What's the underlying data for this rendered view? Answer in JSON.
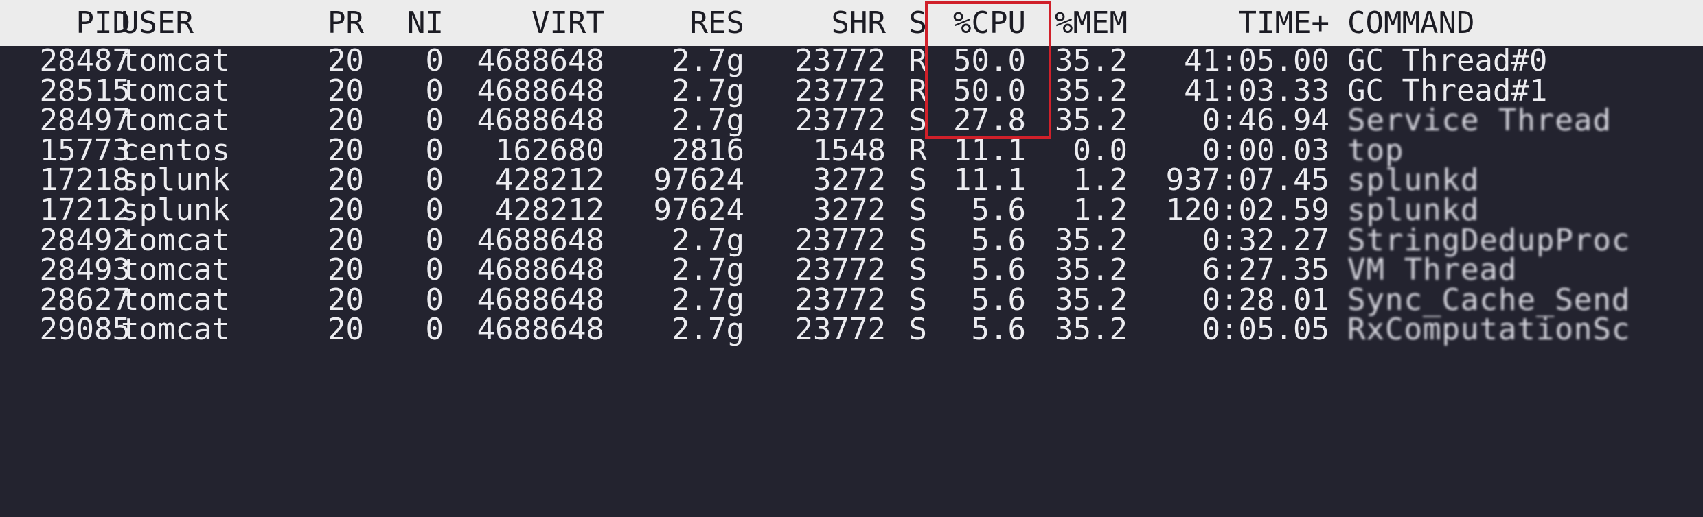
{
  "header": {
    "pid": "PID",
    "user": "USER",
    "pr": "PR",
    "ni": "NI",
    "virt": "VIRT",
    "res": "RES",
    "shr": "SHR",
    "s": "S",
    "cpu": "%CPU",
    "mem": "%MEM",
    "time": "TIME+",
    "command": "COMMAND"
  },
  "processes": [
    {
      "pid": "28487",
      "user": "tomcat",
      "pr": "20",
      "ni": "0",
      "virt": "4688648",
      "res": "2.7g",
      "shr": "23772",
      "s": "R",
      "cpu": "50.0",
      "mem": "35.2",
      "time": "41:05.00",
      "command": "GC Thread#0"
    },
    {
      "pid": "28515",
      "user": "tomcat",
      "pr": "20",
      "ni": "0",
      "virt": "4688648",
      "res": "2.7g",
      "shr": "23772",
      "s": "R",
      "cpu": "50.0",
      "mem": "35.2",
      "time": "41:03.33",
      "command": "GC Thread#1"
    },
    {
      "pid": "28497",
      "user": "tomcat",
      "pr": "20",
      "ni": "0",
      "virt": "4688648",
      "res": "2.7g",
      "shr": "23772",
      "s": "S",
      "cpu": "27.8",
      "mem": "35.2",
      "time": "0:46.94",
      "command": "Service Thread"
    },
    {
      "pid": "15773",
      "user": "centos",
      "pr": "20",
      "ni": "0",
      "virt": "162680",
      "res": "2816",
      "shr": "1548",
      "s": "R",
      "cpu": "11.1",
      "mem": "0.0",
      "time": "0:00.03",
      "command": "top"
    },
    {
      "pid": "17218",
      "user": "splunk",
      "pr": "20",
      "ni": "0",
      "virt": "428212",
      "res": "97624",
      "shr": "3272",
      "s": "S",
      "cpu": "11.1",
      "mem": "1.2",
      "time": "937:07.45",
      "command": "splunkd"
    },
    {
      "pid": "17212",
      "user": "splunk",
      "pr": "20",
      "ni": "0",
      "virt": "428212",
      "res": "97624",
      "shr": "3272",
      "s": "S",
      "cpu": "5.6",
      "mem": "1.2",
      "time": "120:02.59",
      "command": "splunkd"
    },
    {
      "pid": "28492",
      "user": "tomcat",
      "pr": "20",
      "ni": "0",
      "virt": "4688648",
      "res": "2.7g",
      "shr": "23772",
      "s": "S",
      "cpu": "5.6",
      "mem": "35.2",
      "time": "0:32.27",
      "command": "StringDedupProc"
    },
    {
      "pid": "28493",
      "user": "tomcat",
      "pr": "20",
      "ni": "0",
      "virt": "4688648",
      "res": "2.7g",
      "shr": "23772",
      "s": "S",
      "cpu": "5.6",
      "mem": "35.2",
      "time": "6:27.35",
      "command": "VM Thread"
    },
    {
      "pid": "28627",
      "user": "tomcat",
      "pr": "20",
      "ni": "0",
      "virt": "4688648",
      "res": "2.7g",
      "shr": "23772",
      "s": "S",
      "cpu": "5.6",
      "mem": "35.2",
      "time": "0:28.01",
      "command": "Sync_Cache_Send"
    },
    {
      "pid": "29085",
      "user": "tomcat",
      "pr": "20",
      "ni": "0",
      "virt": "4688648",
      "res": "2.7g",
      "shr": "23772",
      "s": "S",
      "cpu": "5.6",
      "mem": "35.2",
      "time": "0:05.05",
      "command": "RxComputationSc"
    }
  ],
  "colors": {
    "background": "#23232f",
    "header_background": "#ececec",
    "highlight_border": "#d0202a"
  }
}
